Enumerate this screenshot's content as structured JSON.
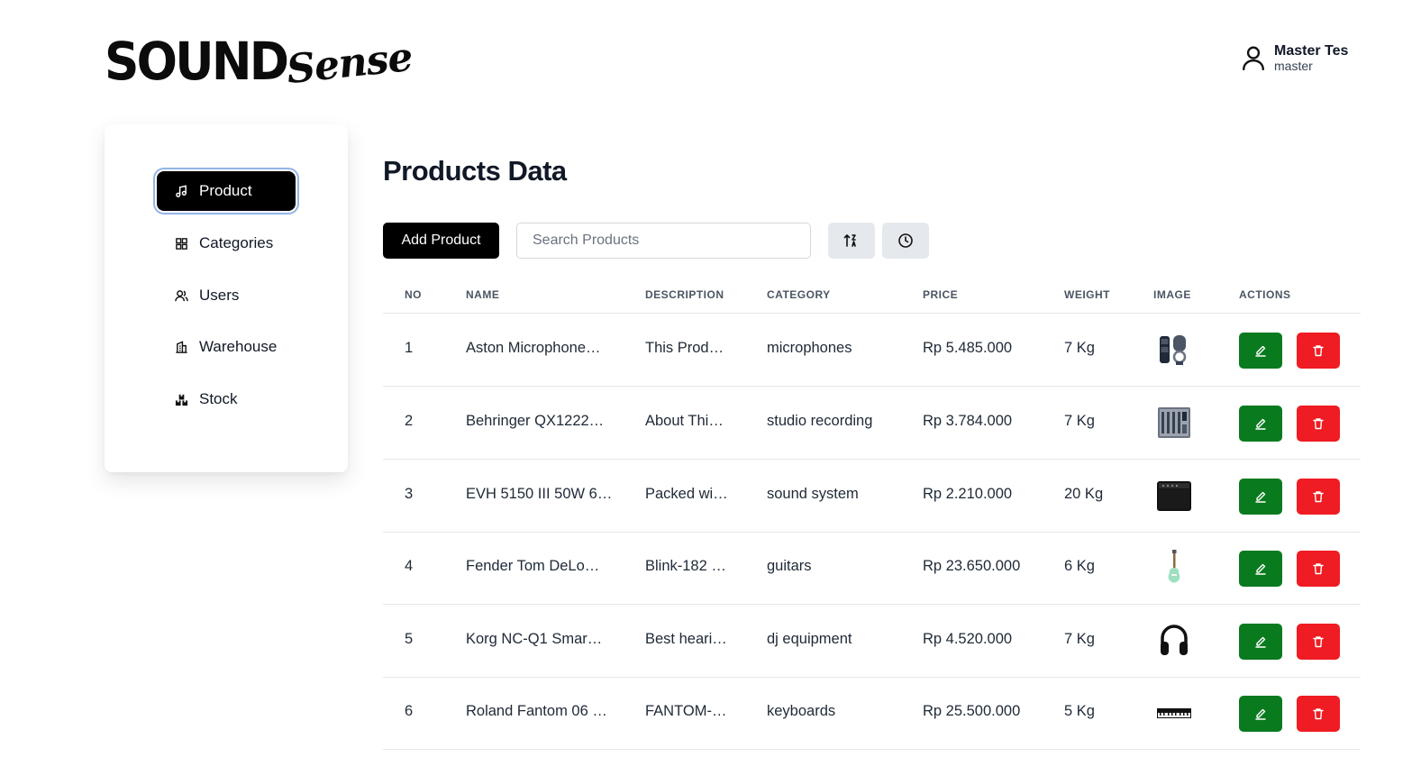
{
  "brand": {
    "word1": "SOUND",
    "word2": "Sense"
  },
  "user": {
    "name": "Master Tes",
    "role": "master"
  },
  "sidebar": {
    "items": [
      {
        "label": "Product",
        "icon": "music-note-icon",
        "active": true
      },
      {
        "label": "Categories",
        "icon": "grid-icon",
        "active": false
      },
      {
        "label": "Users",
        "icon": "users-icon",
        "active": false
      },
      {
        "label": "Warehouse",
        "icon": "warehouse-icon",
        "active": false
      },
      {
        "label": "Stock",
        "icon": "boxes-icon",
        "active": false
      }
    ]
  },
  "main": {
    "title": "Products Data",
    "add_button": "Add Product",
    "search_placeholder": "Search Products",
    "sort_icon": "sort-icon",
    "history_icon": "clock-icon"
  },
  "table": {
    "headers": [
      "NO",
      "NAME",
      "DESCRIPTION",
      "CATEGORY",
      "PRICE",
      "WEIGHT",
      "IMAGE",
      "ACTIONS"
    ],
    "rows": [
      {
        "no": "1",
        "name": "Aston Microphone…",
        "description": "This Prod…",
        "category": "microphones",
        "price": "Rp 5.485.000",
        "weight": "7 Kg",
        "image": "microphone"
      },
      {
        "no": "2",
        "name": "Behringer QX1222…",
        "description": "About Thi…",
        "category": "studio recording",
        "price": "Rp 3.784.000",
        "weight": "7 Kg",
        "image": "mixer"
      },
      {
        "no": "3",
        "name": "EVH 5150 III 50W 6…",
        "description": "Packed wi…",
        "category": "sound system",
        "price": "Rp 2.210.000",
        "weight": "20 Kg",
        "image": "amplifier"
      },
      {
        "no": "4",
        "name": "Fender Tom DeLo…",
        "description": "Blink-182 …",
        "category": "guitars",
        "price": "Rp 23.650.000",
        "weight": "6 Kg",
        "image": "guitar"
      },
      {
        "no": "5",
        "name": "Korg NC-Q1 Smar…",
        "description": "Best heari…",
        "category": "dj equipment",
        "price": "Rp 4.520.000",
        "weight": "7 Kg",
        "image": "headphones"
      },
      {
        "no": "6",
        "name": "Roland Fantom 06 …",
        "description": "FANTOM-…",
        "category": "keyboards",
        "price": "Rp 25.500.000",
        "weight": "5 Kg",
        "image": "keyboard"
      }
    ],
    "edit_icon": "pencil-icon",
    "delete_icon": "trash-icon"
  },
  "colors": {
    "edit": "#0a7a1f",
    "delete": "#ef1c23",
    "primary": "#000000"
  }
}
